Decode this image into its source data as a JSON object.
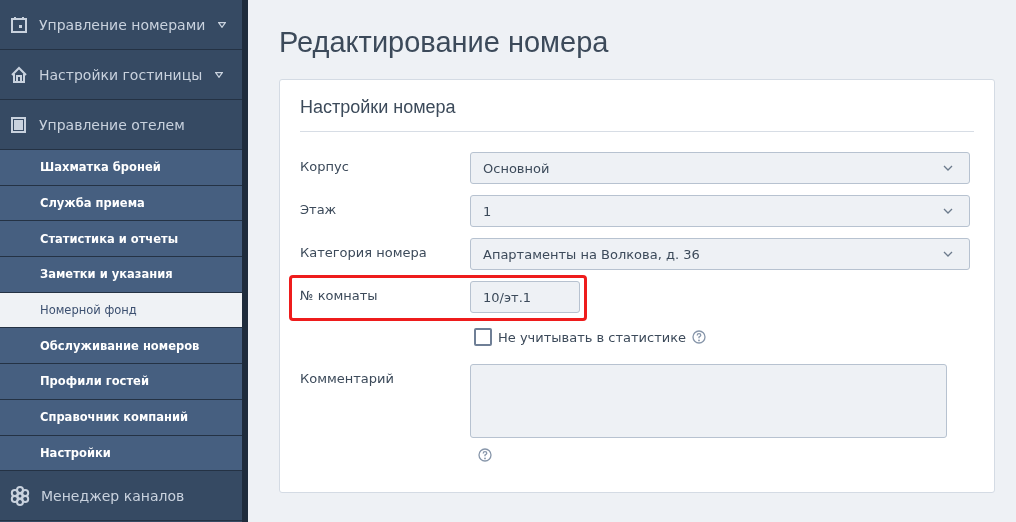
{
  "sidebar": {
    "items": [
      {
        "label": "Управление номерами",
        "caret": true
      },
      {
        "label": "Настройки гостиницы",
        "caret": true
      },
      {
        "label": "Управление отелем",
        "caret": false,
        "children": [
          {
            "label": "Шахматка броней",
            "selected": false
          },
          {
            "label": "Служба приема",
            "selected": false
          },
          {
            "label": "Статистика и отчеты",
            "selected": false
          },
          {
            "label": "Заметки и указания",
            "selected": false
          },
          {
            "label": "Номерной фонд",
            "selected": true
          },
          {
            "label": "Обслуживание номеров",
            "selected": false
          },
          {
            "label": "Профили гостей",
            "selected": false
          },
          {
            "label": "Справочник компаний",
            "selected": false
          },
          {
            "label": "Настройки",
            "selected": false
          }
        ]
      },
      {
        "label": "Менеджер каналов",
        "caret": false
      }
    ]
  },
  "page_title": "Редактирование номера",
  "card": {
    "title": "Настройки номера",
    "fields": [
      {
        "kind": "select",
        "label": "Корпус",
        "value": "Основной"
      },
      {
        "kind": "select",
        "label": "Этаж",
        "value": "1"
      },
      {
        "kind": "select",
        "label": "Категория номера",
        "value": "Апартаменты на Волкова, д. 36"
      },
      {
        "kind": "text",
        "label": "№ комнаты",
        "value": "10/эт.1",
        "highlighted": true
      },
      {
        "kind": "checkbox",
        "label": "Не учитывать в статистике",
        "checked": false,
        "help": true
      },
      {
        "kind": "textarea",
        "label": "Комментарий",
        "help": true
      }
    ]
  }
}
